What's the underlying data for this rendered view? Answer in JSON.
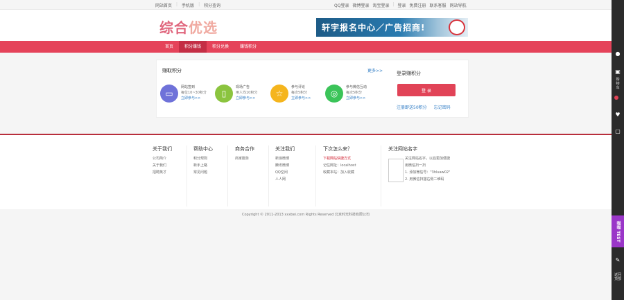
{
  "topbar": {
    "left_links": [
      "网站首页",
      "手机版",
      "积分查询"
    ],
    "right_links": [
      "QQ登录",
      "微博登录",
      "淘宝登录",
      "登录",
      "免费注册",
      "联系客服",
      "网站导航"
    ]
  },
  "header": {
    "logo_part1": "综合",
    "logo_part2": "优选",
    "banner_text": "轩宇报名中心／广告招商!"
  },
  "nav": {
    "items": [
      "首页",
      "积分赚钱",
      "积分兑换",
      "赚钱积分"
    ]
  },
  "earn": {
    "title": "赚取积分",
    "more": "更多>>",
    "cards": [
      {
        "icon_name": "monitor-icon",
        "title": "网站签到",
        "desc": "每位10~30积分",
        "link": "立即参与>>",
        "color": "#6f72d9"
      },
      {
        "icon_name": "phone-icon",
        "title": "现场广告",
        "desc": "用人均10积分",
        "link": "立即参与>>",
        "color": "#8bc43f"
      },
      {
        "icon_name": "star-icon",
        "title": "参与评论",
        "desc": "每次5积分",
        "link": "立即参与>>",
        "color": "#f5b51d"
      },
      {
        "icon_name": "wechat-icon",
        "title": "参与微信互动",
        "desc": "每次5积分",
        "link": "立即参与>>",
        "color": "#3bc459"
      }
    ],
    "login_title": "登录赚积分",
    "login_button": "登 录",
    "login_links": [
      "注册即送50积分",
      "忘记密码"
    ]
  },
  "footer": {
    "columns": [
      {
        "heading": "关于我们",
        "items": [
          "公司简介",
          "关于我们",
          "招聘英才"
        ]
      },
      {
        "heading": "帮助中心",
        "items": [
          "积分规则",
          "新手上路",
          "常见问题"
        ]
      },
      {
        "heading": "商务合作",
        "items": [
          "商家服务"
        ]
      },
      {
        "heading": "关注我们",
        "items": [
          "新浪微博",
          "腾讯微博",
          "QQ空间",
          "人人网"
        ]
      },
      {
        "heading": "下次怎么来？",
        "items": [
          "下载网站快捷方式",
          "记住网址：localhost",
          "收藏本站：加入收藏"
        ]
      },
      {
        "heading": "关注网站名字",
        "items": [
          "关注网站名字，以后更加便捷",
          "用微信扫一扫",
          "1. 添加微信号：\"3hluaw02\"",
          "2. 用微信扫描右侧二维码"
        ]
      }
    ],
    "copyright": "Copyright © 2011-2013 xxxbei.com Rights Reserved 北京时光科技有限公司"
  },
  "sidebar": {
    "labels": [
      "购",
      "物",
      "车"
    ],
    "test_label": "喵喵 TEST",
    "bottom_label": [
      "返回",
      "顶部"
    ]
  },
  "colors": {
    "brand": "#e5435a",
    "nav_active": "#c42e45",
    "link": "#2e7bc4",
    "divider": "#b82e3b"
  }
}
